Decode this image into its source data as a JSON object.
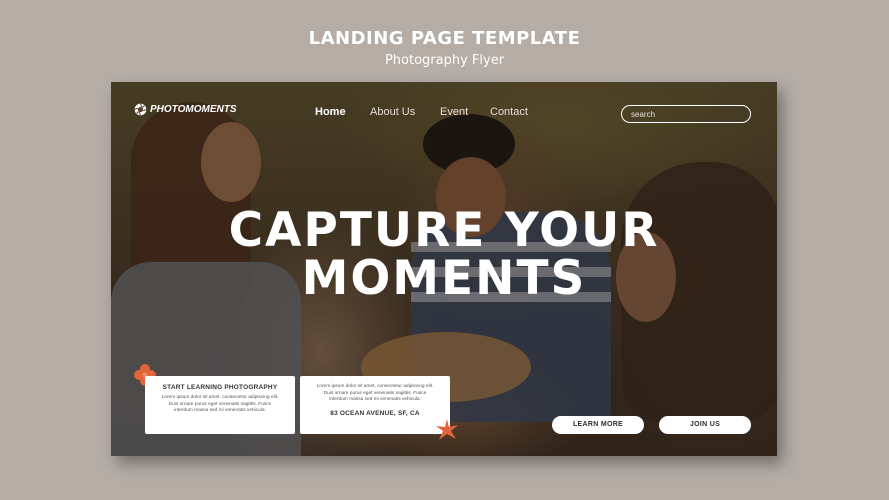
{
  "page": {
    "title": "LANDING PAGE TEMPLATE",
    "subtitle": "Photography Flyer"
  },
  "site": {
    "brand": "PHOTOMOMENTS",
    "nav": [
      {
        "label": "Home",
        "active": true
      },
      {
        "label": "About Us",
        "active": false
      },
      {
        "label": "Event",
        "active": false
      },
      {
        "label": "Contact",
        "active": false
      }
    ],
    "search_placeholder": "search"
  },
  "hero": {
    "line1": "CAPTURE YOUR",
    "line2": "MOMENTS"
  },
  "cards": [
    {
      "title": "START LEARNING PHOTOGRAPHY",
      "text": "Lorem ipsum dolor sit amet, consectetur adipiscing elit. Duis ornare purus eget venenatis sagittis. Fusce interdum massa sed mi venenatis vehicula."
    },
    {
      "title": "83 OCEAN AVENUE, SF, CA",
      "text": "Lorem ipsum dolor sit amet, consectetur adipiscing elit. Duis ornare purus eget venenatis sagittis. Fusce interdum massa sed mi venenatis vehicula."
    }
  ],
  "buttons": {
    "learn_more": "LEARN MORE",
    "join_us": "JOIN US"
  },
  "colors": {
    "background": "#b5aca6",
    "accent": "#e2643c",
    "text_light": "#ffffff"
  },
  "icons": {
    "logo": "aperture-icon",
    "decor": "flower-icon"
  }
}
